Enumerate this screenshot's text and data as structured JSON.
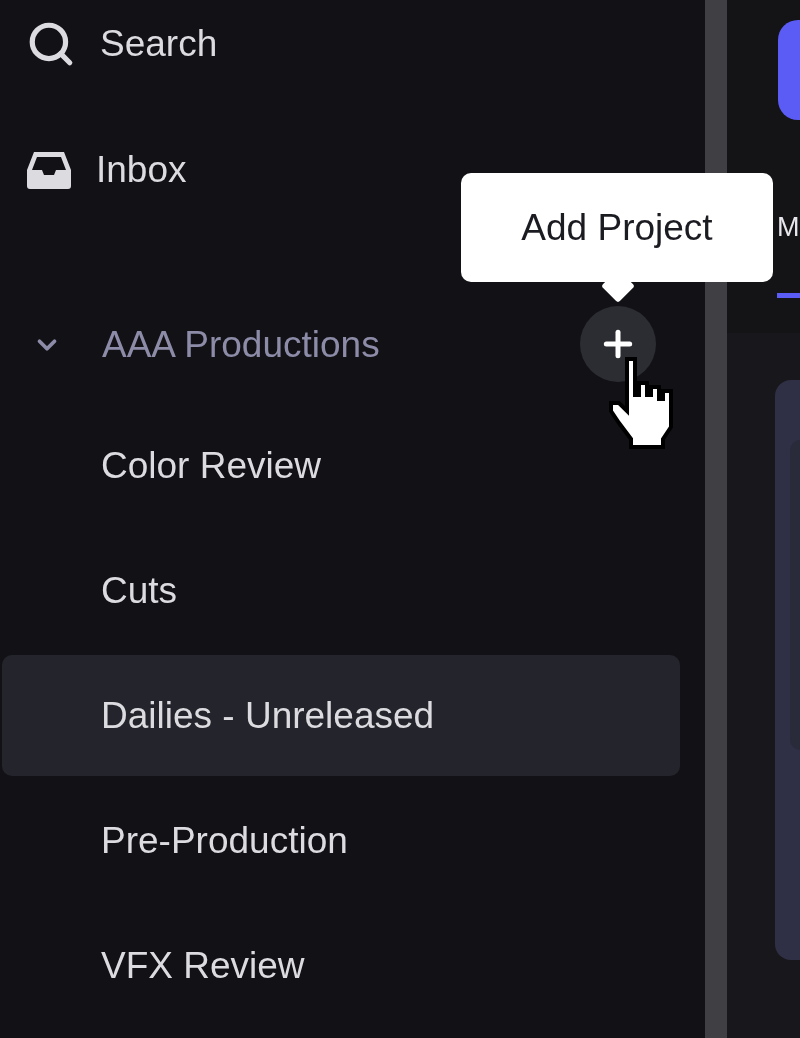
{
  "sidebar": {
    "search": {
      "label": "Search"
    },
    "inbox": {
      "label": "Inbox"
    },
    "workspace": {
      "label": "AAA Productions",
      "expanded": true,
      "children": [
        {
          "label": "Color Review",
          "selected": false
        },
        {
          "label": "Cuts",
          "selected": false
        },
        {
          "label": "Dailies - Unreleased",
          "selected": true
        },
        {
          "label": "Pre-Production",
          "selected": false
        },
        {
          "label": "VFX Review",
          "selected": false
        }
      ]
    }
  },
  "tooltip": {
    "text": "Add Project"
  },
  "main": {
    "tabs": [
      {
        "label": "M",
        "selected": true
      }
    ]
  }
}
